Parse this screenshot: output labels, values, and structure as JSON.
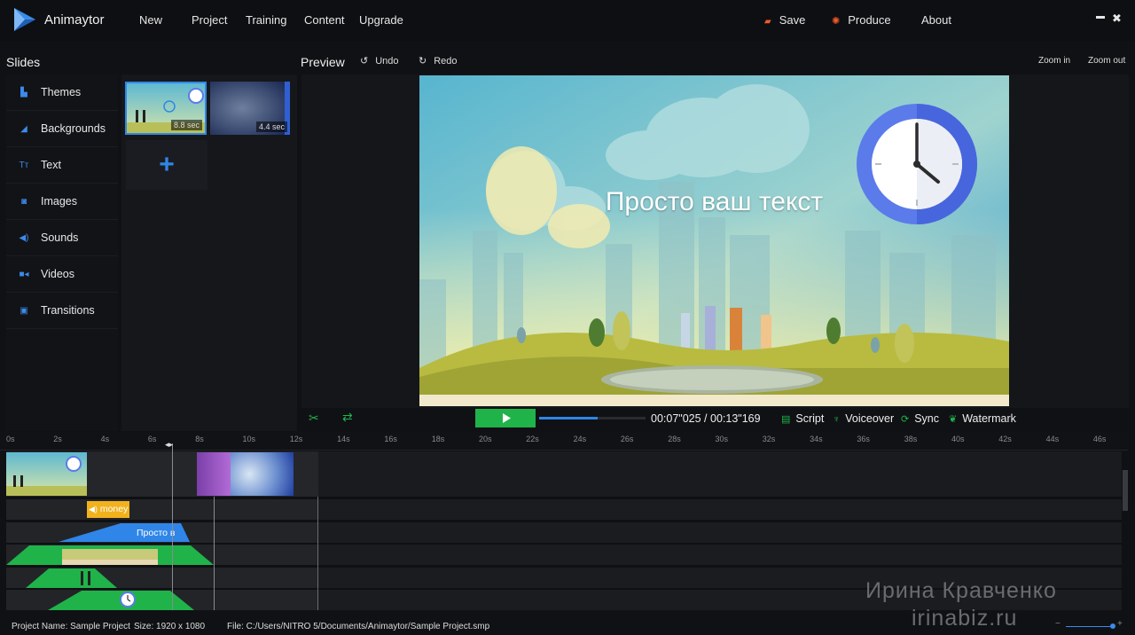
{
  "app": {
    "name": "Animaytor"
  },
  "menu": [
    "New",
    "Project",
    "Training",
    "Content",
    "Upgrade"
  ],
  "toolbar": {
    "save": "Save",
    "produce": "Produce",
    "about": "About"
  },
  "window_controls": {
    "minimize": "▬",
    "close": "✖"
  },
  "slides_label": "Slides",
  "sidebar": [
    {
      "label": "Themes",
      "icon": "themes-icon"
    },
    {
      "label": "Backgrounds",
      "icon": "backgrounds-icon"
    },
    {
      "label": "Text",
      "icon": "text-icon"
    },
    {
      "label": "Images",
      "icon": "images-icon"
    },
    {
      "label": "Sounds",
      "icon": "sounds-icon"
    },
    {
      "label": "Videos",
      "icon": "videos-icon"
    },
    {
      "label": "Transitions",
      "icon": "transitions-icon"
    }
  ],
  "slides": [
    {
      "duration": "8.8 sec"
    },
    {
      "duration": "4.4 sec"
    }
  ],
  "preview": {
    "label": "Preview",
    "undo": "Undo",
    "redo": "Redo",
    "zoom_in": "Zoom in",
    "zoom_out": "Zoom out",
    "canvas_text": "Просто ваш текст"
  },
  "player": {
    "timecode": "00:07\"025 / 00:13\"169",
    "progress": 0.55,
    "script": "Script",
    "voiceover": "Voiceover",
    "sync": "Sync",
    "watermark": "Watermark"
  },
  "ruler": [
    "0s",
    "2s",
    "4s",
    "6s",
    "8s",
    "10s",
    "12s",
    "14s",
    "16s",
    "18s",
    "20s",
    "22s",
    "24s",
    "26s",
    "28s",
    "30s",
    "32s",
    "34s",
    "36s",
    "38s",
    "40s",
    "42s",
    "44s",
    "46s"
  ],
  "timeline": {
    "sound_clip": "money",
    "text_clip": "Просто в"
  },
  "status": {
    "project_name": "Project Name: Sample Project",
    "size": "Size: 1920 x 1080",
    "file": "File: C:/Users/NITRO 5/Documents/Animaytor/Sample Project.smp"
  },
  "watermark_overlay": {
    "line1": "Ирина Кравченко",
    "line2": "irinabiz.ru"
  },
  "colors": {
    "accent": "#2f86e8",
    "green": "#1fb34a",
    "sound": "#f2b21c",
    "purple": "#9b59c7"
  }
}
